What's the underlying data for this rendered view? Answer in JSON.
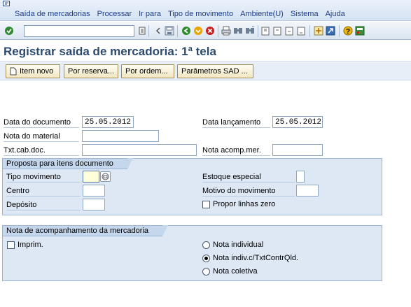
{
  "menu": {
    "items": [
      "Saída de mercadorias",
      "Processar",
      "Ir para",
      "Tipo de movimento",
      "Ambiente(U)",
      "Sistema",
      "Ajuda"
    ]
  },
  "toolbar": {
    "command_value": "",
    "icons": [
      "enter-icon",
      "save-icon",
      "back-icon",
      "exit-icon",
      "cancel-icon",
      "print-icon",
      "find-icon",
      "find-next-icon",
      "first-page-icon",
      "prev-page-icon",
      "next-page-icon",
      "last-page-icon",
      "new-session-icon",
      "shortcut-icon",
      "help-icon",
      "layout-icon"
    ]
  },
  "page": {
    "title": "Registrar saída de mercadoria: 1ª tela"
  },
  "app_toolbar": {
    "new_item": "Item novo",
    "by_reservation": "Por reserva...",
    "by_order": "Por ordem...",
    "sad_params": "Parâmetros SAD ..."
  },
  "header_fields": {
    "doc_date_label": "Data do documento",
    "doc_date_value": "25.05.2012",
    "posting_date_label": "Data lançamento",
    "posting_date_value": "25.05.2012",
    "material_slip_label": "Nota do material",
    "material_slip_value": "",
    "header_text_label": "Txt.cab.doc.",
    "header_text_value": "",
    "delivery_note_label": "Nota acomp.mer.",
    "delivery_note_value": ""
  },
  "defaults_group": {
    "title": "Proposta para itens documento",
    "movement_type_label": "Tipo movimento",
    "movement_type_value": "",
    "special_stock_label": "Estoque especial",
    "special_stock_value": "",
    "plant_label": "Centro",
    "plant_value": "",
    "reason_label": "Motivo do movimento",
    "reason_value": "",
    "storage_label": "Depósito",
    "storage_value": "",
    "zero_lines_label": "Propor linhas zero",
    "zero_lines_checked": false
  },
  "print_group": {
    "title": "Nota de acompanhamento da mercadoria",
    "print_label": "Imprim.",
    "print_checked": false,
    "options": [
      {
        "label": "Nota individual",
        "selected": false
      },
      {
        "label": "Nota indiv.c/TxtContrQld.",
        "selected": true
      },
      {
        "label": "Nota coletiva",
        "selected": false
      }
    ]
  }
}
